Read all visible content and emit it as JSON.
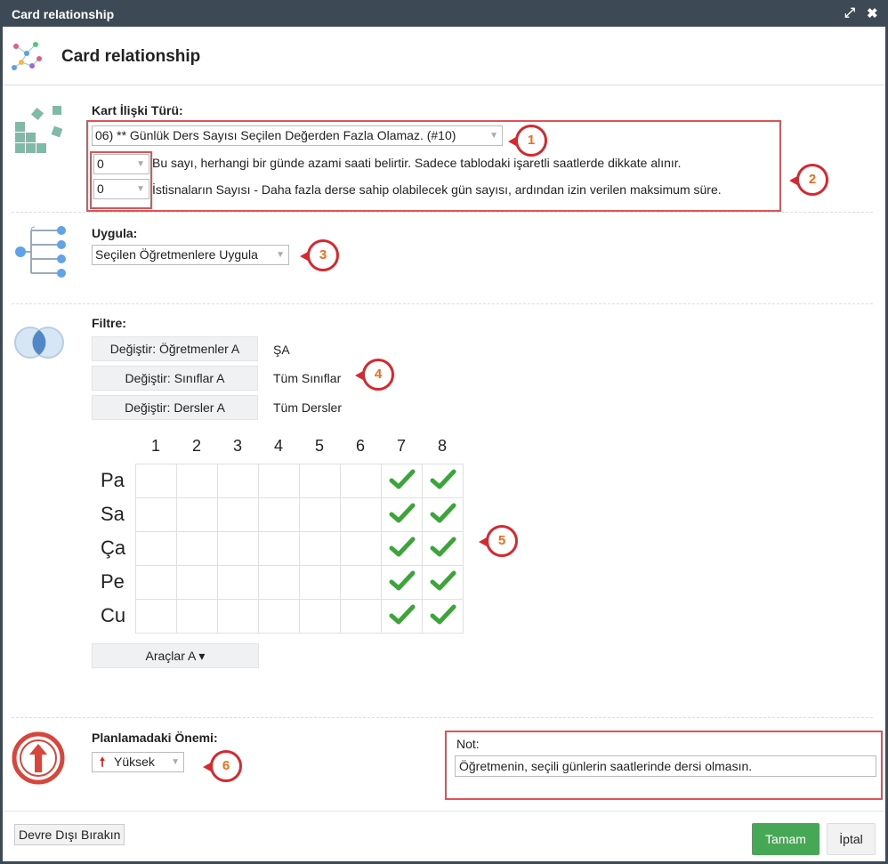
{
  "window": {
    "title": "Card relationship",
    "header_title": "Card relationship"
  },
  "relationship": {
    "label": "Kart İlişki Türü:",
    "type_value": "06) ** Günlük Ders Sayısı Seçilen Değerden Fazla Olamaz. (#10)",
    "param1_value": "0",
    "param1_desc": "Bu sayı, herhangi bir günde azami saati belirtir. Sadece tablodaki işaretli saatlerde dikkate alınır.",
    "param2_value": "0",
    "param2_desc": "İstisnaların Sayısı - Daha fazla derse sahip olabilecek gün sayısı, ardından izin verilen maksimum süre."
  },
  "apply": {
    "label": "Uygula:",
    "value": "Seçilen Öğretmenlere Uygula"
  },
  "filter": {
    "label": "Filtre:",
    "rows": [
      {
        "button": "Değiştir: Öğretmenler A",
        "value": "ŞA"
      },
      {
        "button": "Değiştir: Sınıflar A",
        "value": "Tüm Sınıflar"
      },
      {
        "button": "Değiştir: Dersler A",
        "value": "Tüm Dersler"
      }
    ]
  },
  "timetable": {
    "periods": [
      "1",
      "2",
      "3",
      "4",
      "5",
      "6",
      "7",
      "8"
    ],
    "days": [
      "Pa",
      "Sa",
      "Ça",
      "Pe",
      "Cu"
    ],
    "checked": [
      [
        false,
        false,
        false,
        false,
        false,
        false,
        true,
        true
      ],
      [
        false,
        false,
        false,
        false,
        false,
        false,
        true,
        true
      ],
      [
        false,
        false,
        false,
        false,
        false,
        false,
        true,
        true
      ],
      [
        false,
        false,
        false,
        false,
        false,
        false,
        true,
        true
      ],
      [
        false,
        false,
        false,
        false,
        false,
        false,
        true,
        true
      ]
    ],
    "tools_button": "Araçlar A ▾"
  },
  "importance": {
    "label": "Planlamadaki Önemi:",
    "value": "Yüksek"
  },
  "note": {
    "label": "Not:",
    "value": "Öğretmenin, seçili günlerin saatlerinde dersi olmasın."
  },
  "badges": [
    "1",
    "2",
    "3",
    "4",
    "5",
    "6"
  ],
  "footer": {
    "disable_button": "Devre Dışı Bırakın",
    "ok_button": "Tamam",
    "cancel_button": "İptal"
  },
  "colors": {
    "titlebar": "#3d4a55",
    "ok_green": "#46a855",
    "check_green": "#3aa637",
    "annotation_red": "#d9272e",
    "badge_orange": "#f26a1b"
  }
}
